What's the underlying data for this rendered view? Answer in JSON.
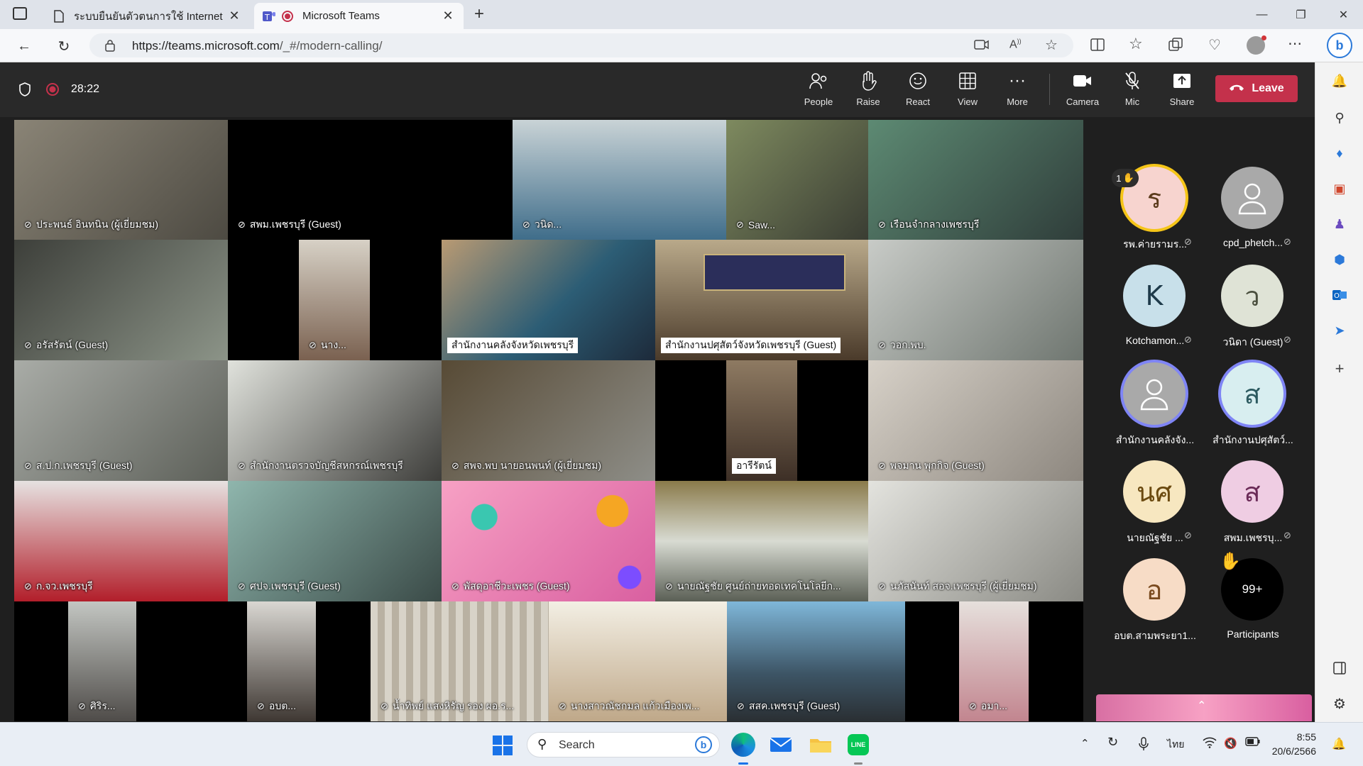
{
  "browser": {
    "tabs": [
      {
        "title": "ระบบยืนยันตัวตนการใช้ Internet",
        "close": "✕"
      },
      {
        "title": "Microsoft Teams",
        "close": "✕"
      }
    ],
    "new_tab": "+",
    "url_host": "https://teams.microsoft.com",
    "url_path": "/_#/modern-calling/"
  },
  "meeting": {
    "timer": "28:22",
    "toolbar": [
      {
        "label": "People",
        "icon": "people-icon"
      },
      {
        "label": "Raise",
        "icon": "raise-hand-icon"
      },
      {
        "label": "React",
        "icon": "react-icon"
      },
      {
        "label": "View",
        "icon": "grid-view-icon"
      },
      {
        "label": "More",
        "icon": "more-icon"
      },
      {
        "label": "Camera",
        "icon": "camera-icon"
      },
      {
        "label": "Mic",
        "icon": "mic-off-icon"
      },
      {
        "label": "Share",
        "icon": "share-icon"
      }
    ],
    "leave_label": "Leave"
  },
  "tiles": [
    {
      "name": "ประพนธ์ อินทนิน (ผู้เยี่ยมชม)",
      "bg": "#6f6a5f"
    },
    {
      "name": "สพม.เพชรบุรี (Guest)",
      "bg": "#000000"
    },
    {
      "name": "วนิด...",
      "bg": "#3f6d8a"
    },
    {
      "name": "Saw...",
      "bg": "#5e6b4a"
    },
    {
      "name": "เรือนจำกลางเพชรบุรี",
      "bg": "#4e6e5b"
    },
    {
      "name": "อรัสรัตน์ (Guest)",
      "bg": "#44483f"
    },
    {
      "name": "นาง...",
      "bg": "#7a6150"
    },
    {
      "name": "สำนักงานคลังจังหวัดเพชรบุรี",
      "bg": "#7d8b8e"
    },
    {
      "name": "สำนักงานปศุสัตว์จังหวัดเพชรบุรี (Guest)",
      "bg": "#6c5a45"
    },
    {
      "name": "วอก.พบ.",
      "bg": "#9da3a0"
    },
    {
      "name": "ส.ป.ก.เพชรบุรี (Guest)",
      "bg": "#8e918b"
    },
    {
      "name": "สำนักงานตรวจบัญชีสหกรณ์เพชรบุรี",
      "bg": "#5f5f5a"
    },
    {
      "name": "สพจ.พบ นายอนพนท์ (ผู้เยี่ยมชม)",
      "bg": "#6b6450"
    },
    {
      "name": "อารีรัตน์",
      "bg": "#6a5a4c"
    },
    {
      "name": "พจมาน พุกกิจ (Guest)",
      "bg": "#b8b1a8"
    },
    {
      "name": "ก.จว.เพชรบุรี",
      "bg": "#c9c4c2"
    },
    {
      "name": "ศปจ.เพชรบุรี (Guest)",
      "bg": "#4f6a66"
    },
    {
      "name": "พัสดุอาชีวะเพชร (Guest)",
      "bg": "#d86fa3"
    },
    {
      "name": "นายณัฐชัย ศูนย์ถ่ายทอดเทคโนโลยีก...",
      "bg": "#6e7a5a"
    },
    {
      "name": "นภัสนันท์ สอจ.เพชรบุรี (ผู้เยี่ยมชม)",
      "bg": "#a9a9a4"
    },
    {
      "name": "ศิริร...",
      "bg": "#6b6b6b"
    },
    {
      "name": "อบต...",
      "bg": "#55504c"
    },
    {
      "name": "น้ำทิพย์ แสงหิรัญ รอง ผอ.ร...",
      "bg": "#8f8574"
    },
    {
      "name": "นางสาวณัชกมล แก้วเมืองเพ...",
      "bg": "#c6b79a"
    },
    {
      "name": "สสค.เพชรบุรี (Guest)",
      "bg": "#4f6678"
    },
    {
      "name": "อมา...",
      "bg": "#b78b94"
    }
  ],
  "participants": [
    {
      "initial": "ร",
      "name": "รพ.ค่ายรามร...",
      "color": "#f7d4cf",
      "raised": "1"
    },
    {
      "initial": "",
      "name": "cpd_phetch...",
      "color": "#a9a9a9"
    },
    {
      "initial": "K",
      "name": "Kotchamon...",
      "color": "#c8e0ea"
    },
    {
      "initial": "ว",
      "name": "วนิดา (Guest)",
      "color": "#dfe3d6"
    },
    {
      "initial": "",
      "name": "สำนักงานคลังจัง...",
      "color": "#a9a9a9"
    },
    {
      "initial": "ส",
      "name": "สำนักงานปศุสัตว์...",
      "color": "#d8eef0"
    },
    {
      "initial": "นศ",
      "name": "นายณัฐชัย ...",
      "color": "#f7e7c0"
    },
    {
      "initial": "ส",
      "name": "สพม.เพชรบุ...",
      "color": "#efcde3"
    },
    {
      "initial": "อ",
      "name": "อบต.สามพระยา1...",
      "color": "#f7dcc6"
    },
    {
      "initial": "99+",
      "name": "Participants",
      "color": "#000000"
    }
  ],
  "taskbar": {
    "search_placeholder": "Search",
    "lang": "ไทย",
    "time": "8:55",
    "date": "20/6/2566"
  }
}
